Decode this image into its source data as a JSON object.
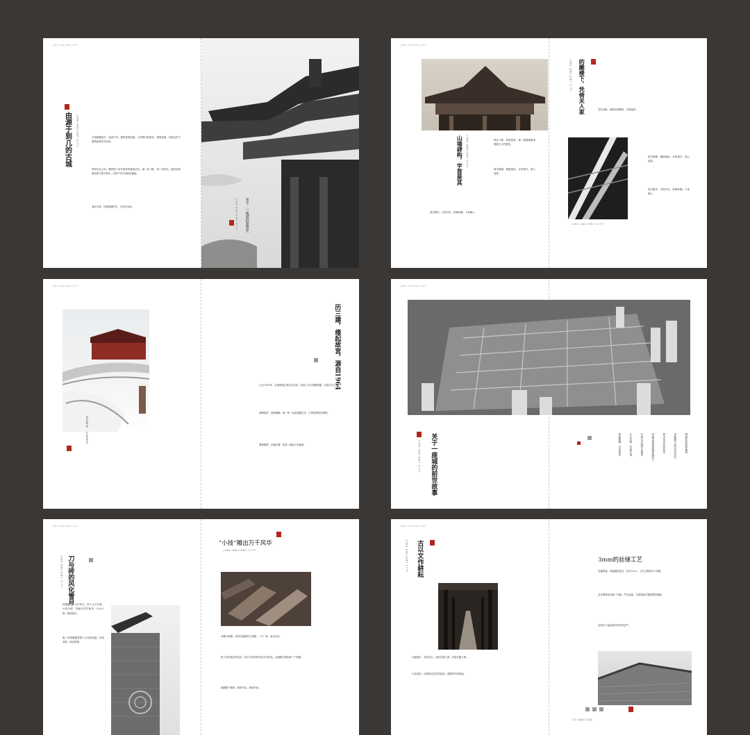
{
  "header": "JIMU ANCIENT CITY",
  "spread1": {
    "title": "由源于到几的古城",
    "en": "JIMU ANCIENT CITY",
    "right_title": "关于 · 一座城的建筑史",
    "right_en": "JIMU ANCIENT CITY",
    "p1": "古城雄踞四方，延续千年，屋檐层叠如翼，斗拱精巧若繁花。檐角起翘，勾勒出东方建筑独有的天际线。",
    "p2": "青砖灰瓦之间，藏着匠人世代相传的营造法式。每一处飞檐，每一块砖石，都诉说着城池的兴衰与荣光，记录下岁月流转的痕迹。",
    "p3": "漫步古城，仿佛穿越时空，与历史对话。"
  },
  "spread2": {
    "title_left": "山墙肆构，字首是其",
    "title_left_en": "JIMU ANCIENT CITY",
    "title_right": "的雕楼下，凭倚关人家",
    "title_right_en": "JIMU ANCIENT CITY",
    "p1": "青瓦飞檐，层层叠叠，每一座楼阁都承载着古人的智慧。",
    "p2": "城中楼阁，雕梁画栋，木构精巧，匠心独具。",
    "p3": "昔日繁华，今犹可见，街巷纵横，人家烟火。",
    "p4": "凭栏远眺，城郭尽收眼底，古意盎然。",
    "caption": "JIMU ANCIENT CITY"
  },
  "spread3": {
    "title": "历三建，缘起故宫，源自1964",
    "caption": "雪后故宫 · 红墙金瓦",
    "p1": "公元1964年，古城修缮工程正式启动，历经三次大规模修建，方成今日之貌。",
    "p2": "城墙依旧，宫阙巍峨，每一砖一瓦皆遵循古法，力求还原历史原貌。",
    "p3": "雪落紫禁，红墙白雪，构成一幅动人的画卷。"
  },
  "spread4": {
    "title": "关于一座城的前世故事",
    "en": "JIMU ANCIENT CITY",
    "cols": [
      "棋盘式的街巷格局，",
      "承载着千年的历史记忆。",
      "城中坊市井然有序，",
      "纵横交错的道路连接四方。",
      "古城以中轴线为基准，",
      "左右对称，布局严谨。",
      "登高俯瞰，尽显恢宏。"
    ]
  },
  "spread5": {
    "title_left": "刀与砖的风化雪月",
    "title_left_en": "JIMU ANCIENT CITY",
    "title_right": "“小技”雕出万千风华",
    "title_right_en": "JIMU ANCIENT CITY",
    "p_left": "砖雕技艺，古已有之。匠人以刀为笔，以砖为纸，刻画出花鸟鱼虫、山水人物，栩栩如生。",
    "p_left2": "每一块砖雕都是匠人心血的结晶，历经风雨，依旧精美。",
    "p_right1": "木雕与砖雕，并称古建装饰之双璧。一刀一刻，皆见功夫。",
    "p_right2": "匠人们传承百年技艺，将平凡的材料化为艺术珍品，点缀着古城的每一个角落。",
    "p_right3": "细看檐下雕饰，繁而不乱，精而不俗。"
  },
  "spread6": {
    "title_left": "古以文作耕耘",
    "title_left_en": "JIMU ANCIENT CITY",
    "title_right": "3mm的丝缝工艺",
    "p_left": "长廊曲折，木柱林立，光影交错之间，尽显古建之美。",
    "p_left2": "行走其间，仿佛听见历史的回响，感受时光的静谧。",
    "p_right1": "丝缝砖墙，砖缝细如发丝，仅约3mm，工艺之精湛令人叹服。",
    "p_right2": "此法需将砖块逐一打磨，严丝合缝，方能成就平整如镜的墙面。",
    "p_right3": "这是古人留给我们的珍贵遗产。",
    "footer": "只有一座城的不可复制"
  }
}
